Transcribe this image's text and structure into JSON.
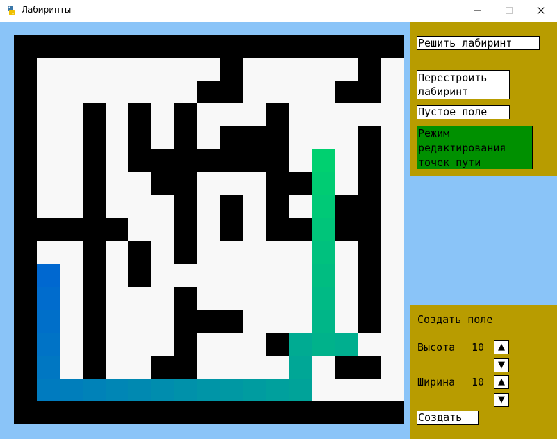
{
  "window": {
    "title": "Лабиринты",
    "icon": "python-snake-icon",
    "controls": [
      "minimize-icon",
      "maximize-icon",
      "close-icon"
    ]
  },
  "colors": {
    "background": "#8ac4f8",
    "panel": "#b89c00",
    "wall": "#000000",
    "floor": "#f8f8f8",
    "active_button": "#009000",
    "path_start": "#00d070",
    "path_end": "#0068d0"
  },
  "controls_panel": {
    "solve": "Решить лабиринт",
    "rebuild": "Перестроить\nлабиринт",
    "empty_field": "Пустое поле",
    "waypoint_mode": "Режим\nредактирования\nточек пути"
  },
  "create_panel": {
    "title": "Создать поле",
    "height_label": "Высота",
    "height_value": "10",
    "width_label": "Ширина",
    "width_value": "10",
    "up_arrow": "▲",
    "down_arrow": "▼",
    "create": "Создать"
  },
  "maze": {
    "rows": 17,
    "cols": 17,
    "grid": [
      "#################",
      "#........#.....#.",
      "#.......##....##.",
      "#..#.#.#...#.....",
      "#..#.#.#.###...#.",
      "#..#.#######...#.",
      "#..#..##...##..#.",
      "#..#...#.#.#..##.",
      "#####..#.#.#####.",
      "#..#.#.#.....#.#.",
      "#..#.#.........#.",
      "#..#...#.......#.",
      "#..#...###.....#.",
      "#..#...#...#.....",
      "#..#..##....#.##.",
      "#..#..............",
      "#################"
    ],
    "path_cells": [
      [
        5,
        13
      ],
      [
        6,
        13
      ],
      [
        7,
        13
      ],
      [
        8,
        13
      ],
      [
        9,
        13
      ],
      [
        10,
        13
      ],
      [
        11,
        13
      ],
      [
        12,
        13
      ],
      [
        13,
        13
      ],
      [
        13,
        14
      ],
      [
        13,
        12
      ],
      [
        14,
        12
      ],
      [
        15,
        12
      ],
      [
        15,
        11
      ],
      [
        15,
        10
      ],
      [
        15,
        9
      ],
      [
        15,
        8
      ],
      [
        15,
        7
      ],
      [
        15,
        6
      ],
      [
        15,
        5
      ],
      [
        15,
        4
      ],
      [
        15,
        3
      ],
      [
        15,
        2
      ],
      [
        15,
        1
      ],
      [
        14,
        1
      ],
      [
        13,
        1
      ],
      [
        12,
        1
      ],
      [
        11,
        1
      ],
      [
        10,
        1
      ]
    ]
  }
}
